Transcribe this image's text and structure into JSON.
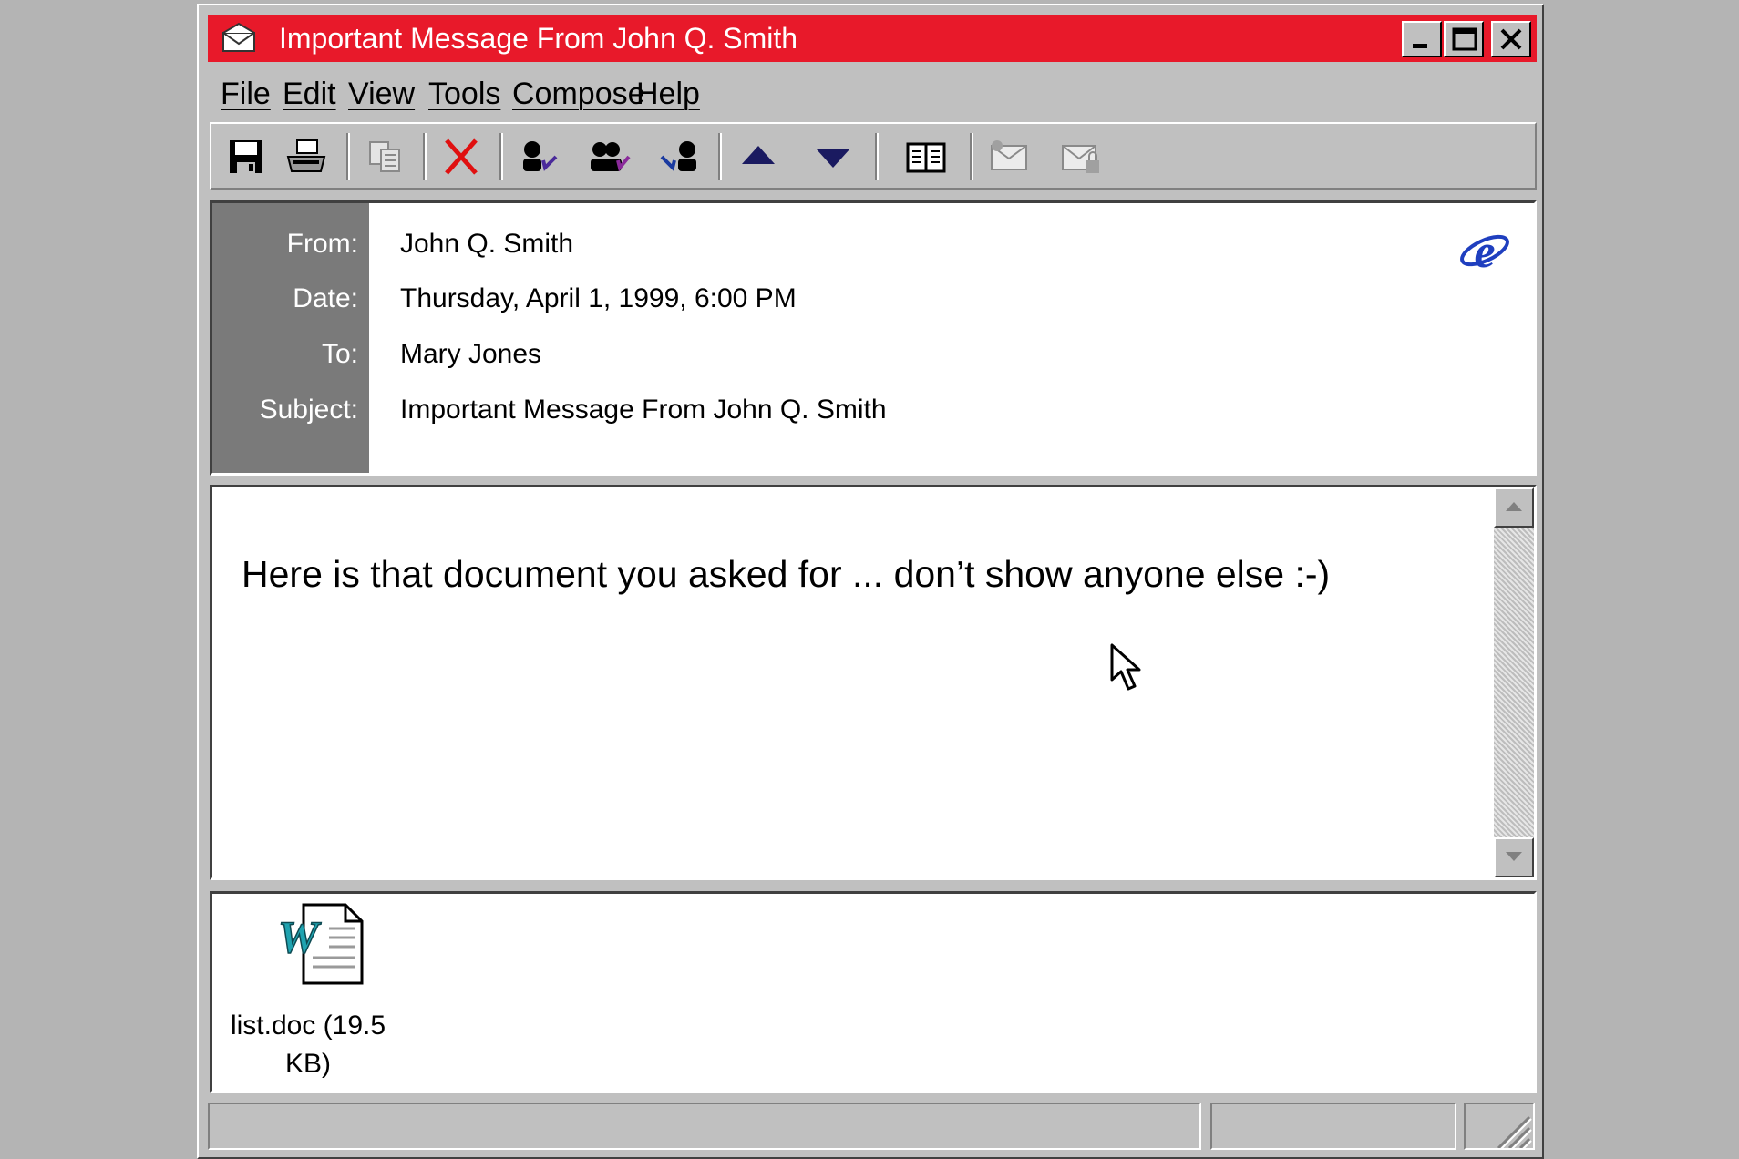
{
  "window": {
    "title": "Important Message From John Q. Smith",
    "title_bar_color": "#e8192a",
    "controls": [
      "minimize-icon",
      "maximize-icon",
      "close-icon"
    ]
  },
  "menu": {
    "items": [
      "File",
      "Edit",
      "View",
      "Tools",
      "Compose",
      "Help"
    ]
  },
  "toolbar": {
    "buttons": [
      "save-icon",
      "print-icon",
      "copy-icon",
      "delete-icon",
      "reply-icon",
      "reply-all-icon",
      "forward-icon",
      "previous-icon",
      "next-icon",
      "address-book-icon",
      "sign-icon",
      "encrypt-icon"
    ]
  },
  "header": {
    "labels": {
      "from": "From:",
      "date": "Date:",
      "to": "To:",
      "subject": "Subject:"
    },
    "from": "John Q. Smith",
    "date": "Thursday, April 1, 1999, 6:00 PM",
    "to": "Mary Jones",
    "subject": "Important Message From John Q. Smith",
    "logo_icon": "internet-explorer-icon"
  },
  "body": {
    "text": "Here is that document you asked for ... don’t show anyone else :-)"
  },
  "attachments": [
    {
      "icon": "word-document-icon",
      "label_line1": "list.doc (19.5",
      "label_line2": "KB)"
    }
  ]
}
